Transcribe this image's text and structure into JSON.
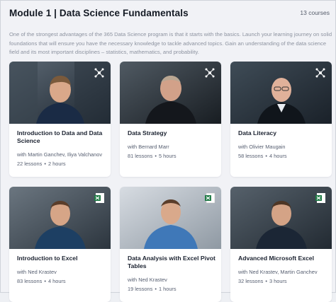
{
  "module": {
    "title": "Module 1 | Data Science Fundamentals",
    "course_count": "13 courses",
    "description": "One of the strongest advantages of the 365 Data Science program is that it starts with the basics. Launch your learning journey on solid foundations that will ensure you have the necessary knowledge to tackle advanced topics. Gain an understanding of the data science field and its most important disciplines – statistics, mathematics, and probability."
  },
  "courses": [
    {
      "title": "Introduction to Data and Data Science",
      "instructor": "with Martin Ganchev, Iliya Valchanov",
      "lessons": "22 lessons",
      "duration": "2 hours",
      "icon": "network-icon"
    },
    {
      "title": "Data Strategy",
      "instructor": "with Bernard Marr",
      "lessons": "81 lessons",
      "duration": "5 hours",
      "icon": "network-icon"
    },
    {
      "title": "Data Literacy",
      "instructor": "with Olivier Maugain",
      "lessons": "58 lessons",
      "duration": "4 hours",
      "icon": "network-icon"
    },
    {
      "title": "Introduction to Excel",
      "instructor": "with Ned Krastev",
      "lessons": "83 lessons",
      "duration": "4 hours",
      "icon": "excel-icon"
    },
    {
      "title": "Data Analysis with Excel Pivot Tables",
      "instructor": "with Ned Krastev",
      "lessons": "19 lessons",
      "duration": "1 hours",
      "icon": "excel-icon"
    },
    {
      "title": "Advanced Microsoft Excel",
      "instructor": "with Ned Krastev, Martin Ganchev",
      "lessons": "32 lessons",
      "duration": "3 hours",
      "icon": "excel-icon"
    }
  ],
  "separator": "•",
  "colors": {
    "thumb_dark": "#1f2a34",
    "thumb_gray": "#4a5560",
    "excel_green": "#1f7a45"
  }
}
